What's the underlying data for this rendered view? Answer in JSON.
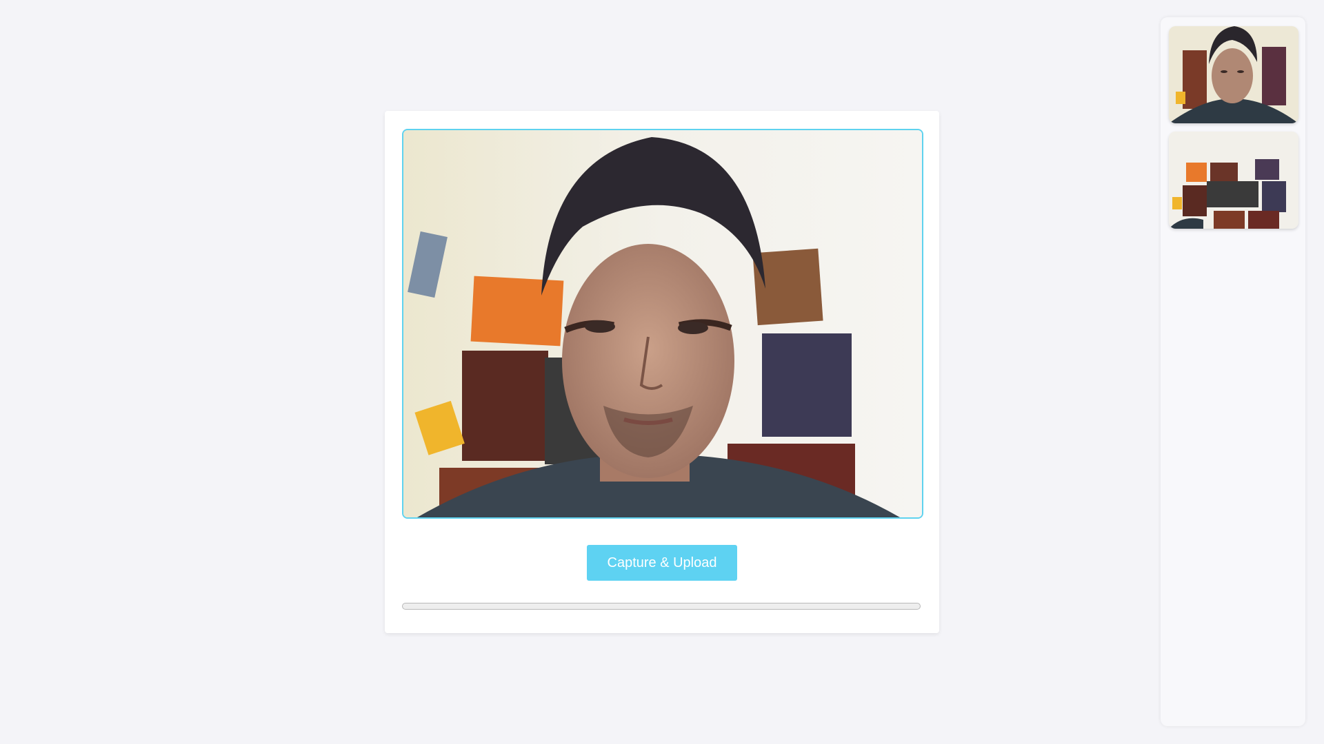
{
  "capture": {
    "button_label": "Capture & Upload",
    "progress_percent": 0
  },
  "video": {
    "content": "webcam-live-feed"
  },
  "gallery": {
    "thumbnails": [
      {
        "content": "captured-photo-face"
      },
      {
        "content": "captured-photo-wall"
      }
    ]
  },
  "colors": {
    "accent": "#5ed2f2",
    "background": "#f4f4f8",
    "card": "#ffffff",
    "progress_track": "#eeeeee"
  }
}
